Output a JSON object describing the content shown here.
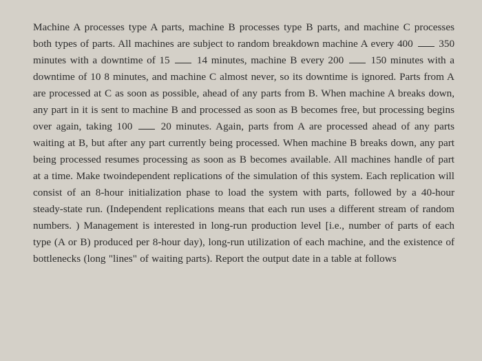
{
  "paragraph": {
    "seg1": "Machine A processes type A parts, machine B processes type B parts, and machine C processes both types of parts. All machines are subject to random breakdown machine A every 400",
    "seg2": "350 minutes with a downtime of 15",
    "seg3": "14 minutes, machine B every 200",
    "seg4": "150 minutes with a downtime of 10 8 minutes, and machine C almost never, so its downtime is ignored. Parts from A are processed at C as soon as possible, ahead of any parts from B. When machine A breaks down, any part in it is sent to machine B and processed as soon as B becomes free, but processing begins over again, taking 100",
    "seg5": "20 minutes. Again, parts from A are processed ahead of any parts waiting at B, but after any part currently being processed. When machine B breaks down, any part being processed resumes processing as soon as B becomes available. All machines handle of part at a time. Make twoindependent replications of the simulation of this system. Each replication will consist of an 8-hour initialization phase to load the system with parts, followed by a 40-hour steady-state run. (Independent replications means that each run uses a different stream of random numbers. ) Management is interested in long-run production level [i.e., number of parts of each type (A or B) produced per 8-hour day), long-run utilization of each machine, and the existence of bottlenecks (long \"lines\" of waiting parts). Report the output date in a table at follows"
  }
}
